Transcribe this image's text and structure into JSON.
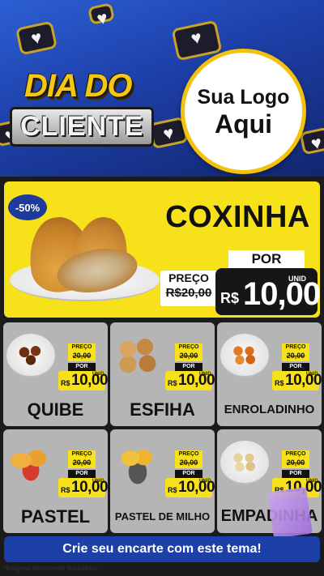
{
  "header": {
    "title_line1": "DIA DO",
    "title_line2": "CLIENTE",
    "logo_line1": "Sua Logo",
    "logo_line2": "Aqui"
  },
  "featured": {
    "discount_badge": "-50%",
    "name": "COXINHA",
    "price_label": "PREÇO",
    "old_price": "R$20,00",
    "por_label": "POR",
    "unit_label": "UNID",
    "currency": "R$",
    "new_price": "10,00"
  },
  "products": [
    {
      "name": "QUIBE",
      "price_label": "PREÇO",
      "old_price": "20,00",
      "por_label": "POR",
      "currency": "R$",
      "new_price": "10,00",
      "unit_label": "UNID"
    },
    {
      "name": "ESFIHA",
      "price_label": "PREÇO",
      "old_price": "20,00",
      "por_label": "POR",
      "currency": "R$",
      "new_price": "10,00",
      "unit_label": "UNID"
    },
    {
      "name": "ENROLADINHO",
      "price_label": "PREÇO",
      "old_price": "20,00",
      "por_label": "POR",
      "currency": "R$",
      "new_price": "10,00",
      "unit_label": "UNID"
    },
    {
      "name": "PASTEL",
      "price_label": "PREÇO",
      "old_price": "20,00",
      "por_label": "POR",
      "currency": "R$",
      "new_price": "10,00",
      "unit_label": "UNID"
    },
    {
      "name": "PASTEL DE MILHO",
      "price_label": "PREÇO",
      "old_price": "20,00",
      "por_label": "POR",
      "currency": "R$",
      "new_price": "10,00",
      "unit_label": "UNID"
    },
    {
      "name": "EMPADINHA",
      "price_label": "PREÇO",
      "old_price": "20,00",
      "por_label": "POR",
      "currency": "R$",
      "new_price": "10,00",
      "unit_label": "UNID"
    }
  ],
  "footer": {
    "cta_label": "Crie seu encarte com este tema!",
    "disclaimer": "*Imagens Meramente Ilustrativas"
  },
  "colors": {
    "brand_blue": "#1d3fa8",
    "accent_yellow": "#f7e11b",
    "card_gray": "#b5b5b5",
    "dark_bg": "#1b1b1b"
  }
}
